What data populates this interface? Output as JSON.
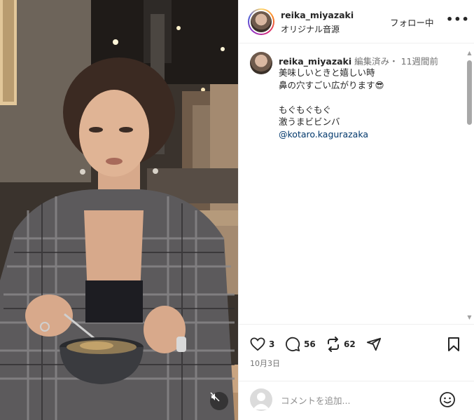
{
  "post": {
    "username": "reika_miyazaki",
    "audio_label": "オリジナル音源",
    "follow_label": "フォロー中",
    "more_label": "•••"
  },
  "caption": {
    "username": "reika_miyazaki",
    "meta": "編集済み・ 11週間前",
    "lines": [
      "美味しいときと嬉しい時",
      "鼻の穴すごい広がります😎",
      "もぐもぐもぐ",
      "激うまビビンバ"
    ],
    "mention": "@kotaro.kagurazaka"
  },
  "actions": {
    "likes": "3",
    "comments": "56",
    "reposts": "62"
  },
  "date": "10月3日",
  "comment_input": {
    "placeholder": "コメントを追加..."
  },
  "icons": [
    "heart-icon",
    "comment-icon",
    "repost-icon",
    "share-icon",
    "bookmark-icon",
    "emoji-icon",
    "mute-icon",
    "more-icon"
  ],
  "colors": {
    "mention": "#00376b",
    "meta": "#737373",
    "divider": "#efefef"
  }
}
